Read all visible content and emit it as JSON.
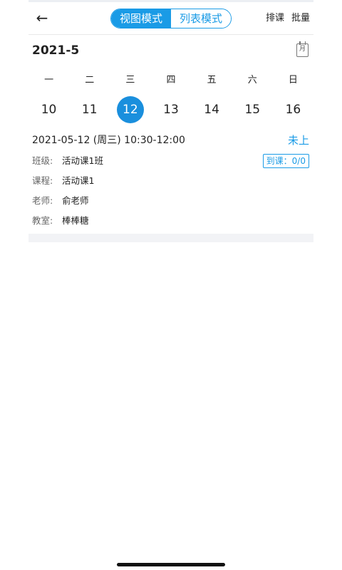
{
  "header": {
    "back_icon": "arrow-left-icon",
    "mode_view": "视图模式",
    "mode_list": "列表模式",
    "action_schedule": "排课",
    "action_batch": "批量",
    "accent_color": "#1a9be6"
  },
  "calendar": {
    "month": "2021-5",
    "month_icon_text": "月",
    "weekdays": [
      "一",
      "二",
      "三",
      "四",
      "五",
      "六",
      "日"
    ],
    "dates": [
      "10",
      "11",
      "12",
      "13",
      "14",
      "15",
      "16"
    ],
    "selected_date": "12"
  },
  "lesson": {
    "time": "2021-05-12 (周三) 10:30-12:00",
    "status": "未上",
    "attendance": "到课：0/0",
    "class_label": "班级:",
    "class_value": "活动课1班",
    "course_label": "课程:",
    "course_value": "活动课1",
    "teacher_label": "老师:",
    "teacher_value": "俞老师",
    "room_label": "教室:",
    "room_value": "棒棒糖"
  }
}
